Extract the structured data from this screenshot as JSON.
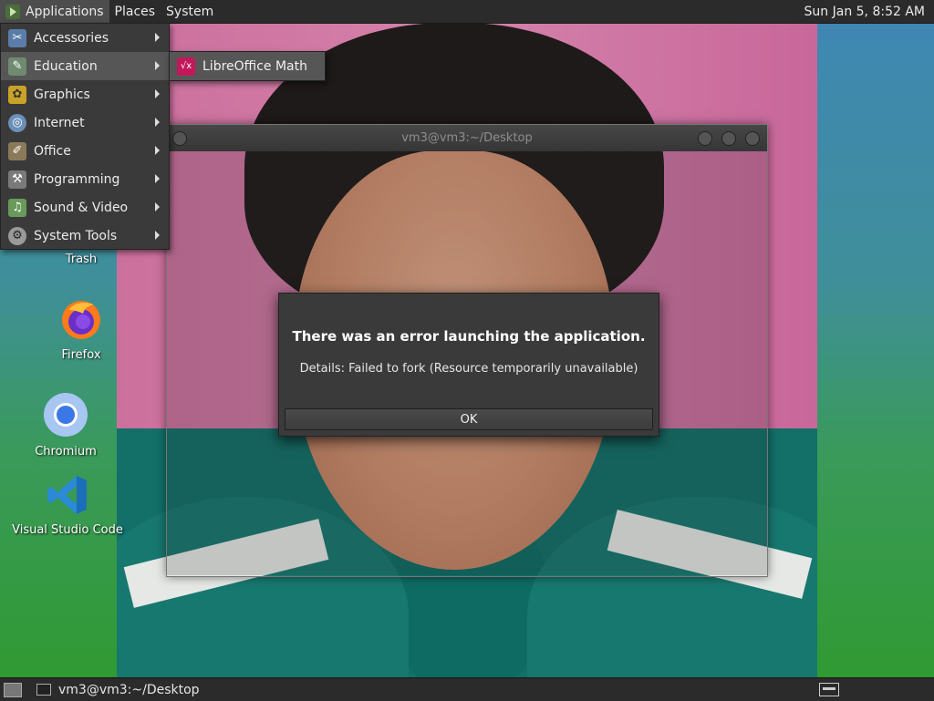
{
  "top_panel": {
    "menus": [
      "Applications",
      "Places",
      "System"
    ],
    "clock": "Sun Jan  5,  8:52 AM"
  },
  "apps_menu": {
    "items": [
      {
        "label": "Accessories",
        "icon": "accessories-icon"
      },
      {
        "label": "Education",
        "icon": "education-icon"
      },
      {
        "label": "Graphics",
        "icon": "graphics-icon"
      },
      {
        "label": "Internet",
        "icon": "internet-icon"
      },
      {
        "label": "Office",
        "icon": "office-icon"
      },
      {
        "label": "Programming",
        "icon": "programming-icon"
      },
      {
        "label": "Sound & Video",
        "icon": "sound-video-icon"
      },
      {
        "label": "System Tools",
        "icon": "system-tools-icon"
      }
    ],
    "active_index": 1,
    "submenu": {
      "label": "LibreOffice Math",
      "icon": "libreoffice-math-icon"
    }
  },
  "desktop_icons": [
    {
      "label": "Trash",
      "icon": "trash-icon"
    },
    {
      "label": "Firefox",
      "icon": "firefox-icon"
    },
    {
      "label": "Chromium",
      "icon": "chromium-icon"
    },
    {
      "label": "Visual Studio Code",
      "icon": "vscode-icon"
    }
  ],
  "terminal": {
    "title": "vm3@vm3:~/Desktop"
  },
  "dialog": {
    "primary": "There was an error launching the application.",
    "secondary": "Details: Failed to fork (Resource temporarily unavailable)",
    "ok_label": "OK"
  },
  "bottom_panel": {
    "task_label": "vm3@vm3:~/Desktop"
  },
  "colors": {
    "panel": "#2b2b2b",
    "menu_bg": "#3a3a3a",
    "menu_active": "#565656",
    "libreoffice_math": "#c2185b"
  }
}
